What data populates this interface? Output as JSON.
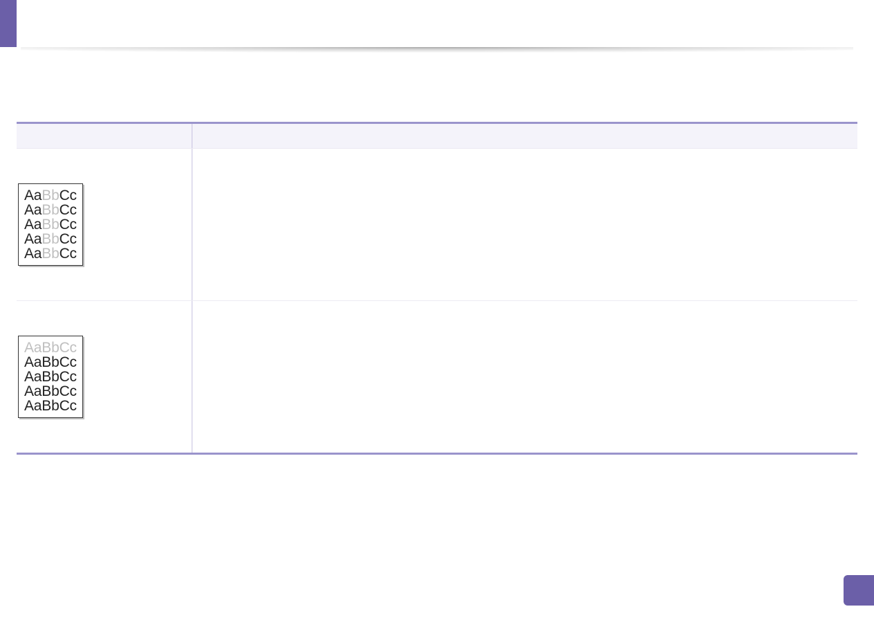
{
  "sample_rows": [
    {
      "lines": [
        {
          "segments": [
            {
              "t": "Aa",
              "faded": false
            },
            {
              "t": "Bb",
              "faded": true
            },
            {
              "t": "Cc",
              "faded": false
            }
          ]
        },
        {
          "segments": [
            {
              "t": "Aa",
              "faded": false
            },
            {
              "t": "Bb",
              "faded": true
            },
            {
              "t": "Cc",
              "faded": false
            }
          ]
        },
        {
          "segments": [
            {
              "t": "Aa",
              "faded": false
            },
            {
              "t": "Bb",
              "faded": true
            },
            {
              "t": "Cc",
              "faded": false
            }
          ]
        },
        {
          "segments": [
            {
              "t": "Aa",
              "faded": false
            },
            {
              "t": "Bb",
              "faded": true
            },
            {
              "t": "Cc",
              "faded": false
            }
          ]
        },
        {
          "segments": [
            {
              "t": "Aa",
              "faded": false
            },
            {
              "t": "Bb",
              "faded": true
            },
            {
              "t": "Cc",
              "faded": false
            }
          ]
        }
      ]
    },
    {
      "lines": [
        {
          "segments": [
            {
              "t": "AaBbCc",
              "faded": true
            }
          ]
        },
        {
          "segments": [
            {
              "t": "AaBbCc",
              "faded": false
            }
          ]
        },
        {
          "segments": [
            {
              "t": "AaBbCc",
              "faded": false
            }
          ]
        },
        {
          "segments": [
            {
              "t": "AaBbCc",
              "faded": false
            }
          ]
        },
        {
          "segments": [
            {
              "t": "AaBbCc",
              "faded": false
            }
          ]
        }
      ]
    }
  ],
  "colors": {
    "accent": "#6b5fa8",
    "table_border": "#9a94cc"
  }
}
